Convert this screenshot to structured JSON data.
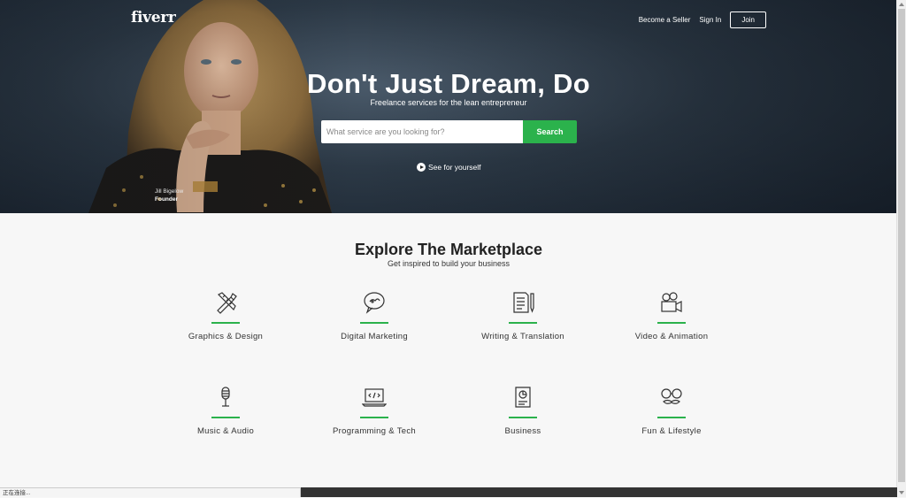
{
  "header": {
    "logo": "fiverr",
    "nav": {
      "become_seller": "Become a Seller",
      "sign_in": "Sign In",
      "join": "Join"
    }
  },
  "hero": {
    "headline": "Don't Just Dream, Do",
    "subline": "Freelance services for the lean entrepreneur",
    "search_placeholder": "What service are you looking for?",
    "search_button": "Search",
    "see_link": "See for yourself",
    "caption_name": "Jill Bigelow",
    "caption_role": "Founder"
  },
  "explore": {
    "title": "Explore The Marketplace",
    "subtitle": "Get inspired to build your business",
    "categories": [
      {
        "label": "Graphics & Design",
        "icon": "pencil-ruler-icon"
      },
      {
        "label": "Digital Marketing",
        "icon": "speech-bubble-icon"
      },
      {
        "label": "Writing & Translation",
        "icon": "document-pen-icon"
      },
      {
        "label": "Video & Animation",
        "icon": "video-camera-icon"
      },
      {
        "label": "Music & Audio",
        "icon": "microphone-icon"
      },
      {
        "label": "Programming & Tech",
        "icon": "laptop-code-icon"
      },
      {
        "label": "Business",
        "icon": "report-chart-icon"
      },
      {
        "label": "Fun & Lifestyle",
        "icon": "glasses-mustache-icon"
      }
    ]
  },
  "status_bar": {
    "text": "正在连接..."
  },
  "colors": {
    "accent": "#2bb24c",
    "hero_bg": "#2c3946",
    "page_bg": "#f7f7f7"
  }
}
